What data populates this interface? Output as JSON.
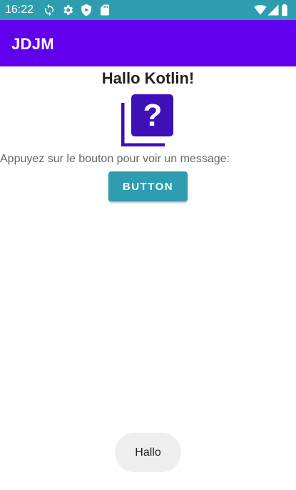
{
  "status_bar": {
    "time": "16:22",
    "background_color": "#2f9db0",
    "left_icons": [
      "sync-icon",
      "settings-icon",
      "shield-play-icon",
      "sd-card-icon"
    ],
    "right_icons": [
      "wifi-icon",
      "signal-icon",
      "battery-icon"
    ]
  },
  "app_bar": {
    "title": "JDJM",
    "background_color": "#6200ee"
  },
  "main": {
    "title": "Hallo Kotlin!",
    "icon": "help-question-icon",
    "icon_color": "#3f0fb8",
    "instruction": "Appuyez sur le bouton pour voir un message:",
    "button_label": "Button",
    "button_color": "#2f9db0"
  },
  "toast": {
    "message": "Hallo"
  }
}
